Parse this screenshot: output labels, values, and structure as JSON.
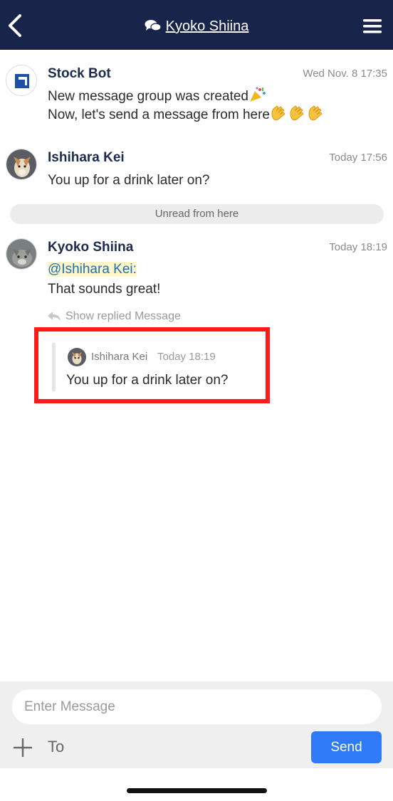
{
  "header": {
    "title": "Kyoko Shiina",
    "back_icon": "chevron-left-icon",
    "chat_icon": "chat-bubbles-icon",
    "menu_icon": "hamburger-menu-icon",
    "bg_color": "#18244a"
  },
  "messages": [
    {
      "sender": "Stock Bot",
      "time": "Wed Nov. 8 17:35",
      "lines": [
        "New message group was created",
        "Now, let's send a message from here"
      ]
    },
    {
      "sender": "Ishihara Kei",
      "time": "Today 17:56",
      "lines": [
        "You up for a drink later on?"
      ]
    },
    {
      "sender": "Kyoko Shiina",
      "time": "Today 18:19",
      "mention": "@Ishihara Kei:",
      "lines": [
        "That sounds great!"
      ]
    }
  ],
  "unread_label": "Unread from here",
  "show_replied_label": "Show replied Message",
  "reply_quote": {
    "sender": "Ishihara Kei",
    "time": "Today 18:19",
    "text": "You up for a drink later on?"
  },
  "composer": {
    "placeholder": "Enter Message",
    "to_label": "To",
    "send_label": "Send",
    "send_color": "#2f7af6"
  }
}
